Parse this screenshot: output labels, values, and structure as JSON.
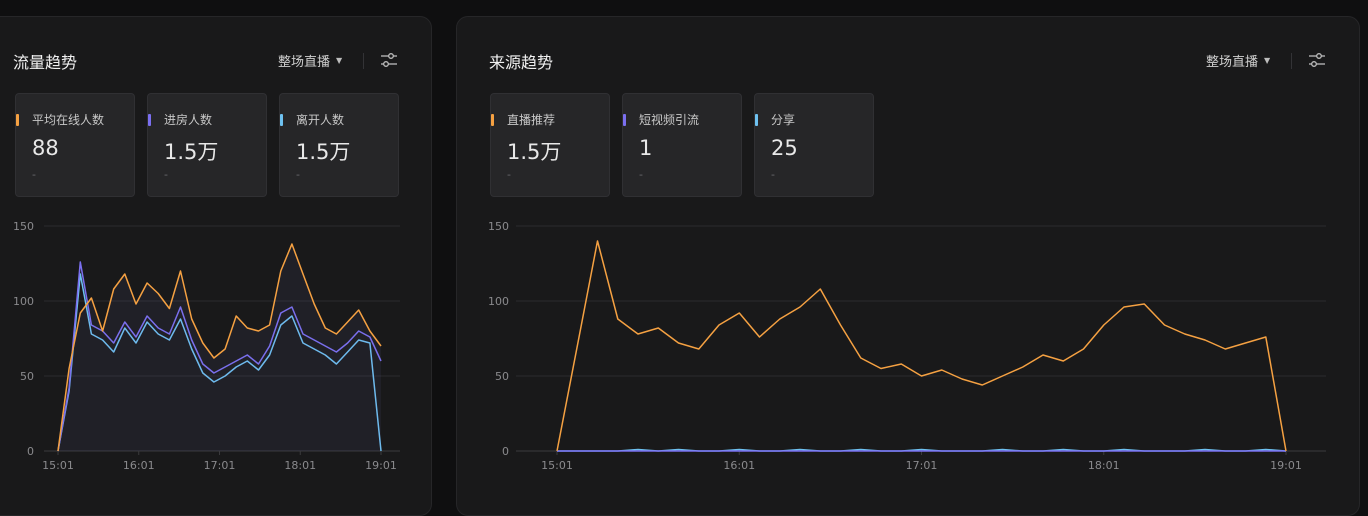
{
  "left": {
    "title": "流量趋势",
    "scope": "整场直播",
    "cards": [
      {
        "label": "平均在线人数",
        "value": "88",
        "sub": "-",
        "color": "#f5a142"
      },
      {
        "label": "进房人数",
        "value": "1.5万",
        "sub": "-",
        "color": "#7b6ff0"
      },
      {
        "label": "离开人数",
        "value": "1.5万",
        "sub": "-",
        "color": "#6ec1f0"
      }
    ]
  },
  "right": {
    "title": "来源趋势",
    "scope": "整场直播",
    "cards": [
      {
        "label": "直播推荐",
        "value": "1.5万",
        "sub": "-",
        "color": "#f5a142"
      },
      {
        "label": "短视频引流",
        "value": "1",
        "sub": "-",
        "color": "#7b6ff0"
      },
      {
        "label": "分享",
        "value": "25",
        "sub": "-",
        "color": "#6ec1f0"
      }
    ]
  },
  "chart_data": [
    {
      "type": "line",
      "title": "流量趋势",
      "x_ticks": [
        "15:01",
        "16:01",
        "17:01",
        "18:01",
        "19:01"
      ],
      "y_ticks": [
        0,
        50,
        100,
        150
      ],
      "ylim": [
        0,
        150
      ],
      "grid": true,
      "series": [
        {
          "name": "平均在线人数",
          "color": "#f5a142",
          "values": [
            0,
            55,
            92,
            102,
            80,
            108,
            118,
            98,
            112,
            105,
            95,
            120,
            88,
            72,
            62,
            68,
            90,
            82,
            80,
            84,
            120,
            138,
            118,
            98,
            82,
            78,
            86,
            94,
            80,
            70
          ]
        },
        {
          "name": "进房人数",
          "color": "#7b6ff0",
          "values": [
            0,
            42,
            126,
            84,
            80,
            72,
            86,
            76,
            90,
            82,
            78,
            96,
            74,
            58,
            52,
            56,
            60,
            64,
            58,
            70,
            92,
            96,
            78,
            74,
            70,
            66,
            72,
            80,
            76,
            60
          ]
        },
        {
          "name": "离开人数",
          "color": "#6ec1f0",
          "values": [
            0,
            40,
            118,
            78,
            74,
            66,
            82,
            72,
            86,
            78,
            74,
            88,
            68,
            52,
            46,
            50,
            56,
            60,
            54,
            64,
            84,
            90,
            72,
            68,
            64,
            58,
            66,
            74,
            72,
            0
          ]
        }
      ]
    },
    {
      "type": "line",
      "title": "来源趋势",
      "x_ticks": [
        "15:01",
        "16:01",
        "17:01",
        "18:01",
        "19:01"
      ],
      "y_ticks": [
        0,
        50,
        100,
        150
      ],
      "ylim": [
        0,
        150
      ],
      "grid": true,
      "series": [
        {
          "name": "直播推荐",
          "color": "#f5a142",
          "values": [
            0,
            70,
            140,
            88,
            78,
            82,
            72,
            68,
            84,
            92,
            76,
            88,
            96,
            108,
            84,
            62,
            55,
            58,
            50,
            54,
            48,
            44,
            50,
            56,
            64,
            60,
            68,
            84,
            96,
            98,
            84,
            78,
            74,
            68,
            72,
            76,
            0
          ]
        },
        {
          "name": "短视频引流",
          "color": "#7b6ff0",
          "values": [
            0,
            0,
            0,
            0,
            0,
            0,
            0,
            0,
            0,
            0,
            0,
            0,
            0,
            0,
            0,
            0,
            0,
            0,
            0,
            0,
            0,
            0,
            0,
            0,
            0,
            0,
            0,
            0,
            0,
            0,
            0,
            0,
            0,
            0,
            0,
            0,
            0
          ]
        },
        {
          "name": "分享",
          "color": "#6ec1f0",
          "values": [
            0,
            0,
            0,
            0,
            1,
            0,
            1,
            0,
            0,
            1,
            0,
            0,
            1,
            0,
            0,
            1,
            0,
            0,
            1,
            0,
            0,
            0,
            1,
            0,
            0,
            1,
            0,
            0,
            1,
            0,
            0,
            0,
            1,
            0,
            0,
            1,
            0
          ]
        }
      ]
    }
  ]
}
